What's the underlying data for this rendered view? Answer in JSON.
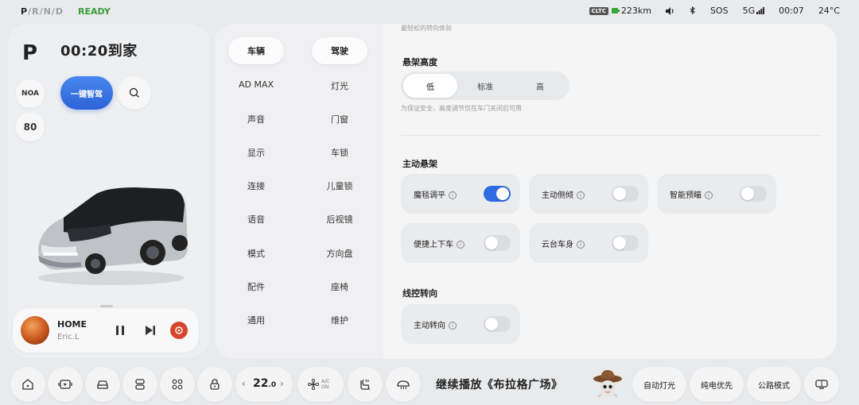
{
  "status": {
    "gears": [
      "P",
      "R",
      "N",
      "D"
    ],
    "ready": "READY",
    "cltc": "CLTC",
    "range": "223km",
    "sos": "SOS",
    "network": "5G",
    "time": "00:07",
    "temperature": "24°C"
  },
  "left": {
    "gear": "P",
    "eta": "00:20到家",
    "noa": "NOA",
    "speed": "80",
    "smart_drive": "一键智驾",
    "music": {
      "title": "HOME",
      "artist": "Eric.L"
    }
  },
  "nav": {
    "tabs": [
      "车辆",
      "驾驶"
    ],
    "left_items": [
      "AD MAX",
      "声音",
      "显示",
      "连接",
      "语音",
      "模式",
      "配件",
      "通用"
    ],
    "right_items": [
      "灯光",
      "门窗",
      "车锁",
      "儿童锁",
      "后视镜",
      "方向盘",
      "座椅",
      "维护"
    ]
  },
  "content": {
    "top_hint": "最轻松的转向体验",
    "suspension_height": {
      "title": "悬架高度",
      "options": [
        "低",
        "标准",
        "高"
      ],
      "selected": "低",
      "note": "为保证安全，高度调节仅在车门关闭后可用"
    },
    "active_suspension": {
      "title": "主动悬架",
      "items": [
        {
          "label": "魔毯调平",
          "on": true
        },
        {
          "label": "主动侧倾",
          "on": false
        },
        {
          "label": "智能预瞄",
          "on": false
        },
        {
          "label": "便捷上下车",
          "on": false
        },
        {
          "label": "云台车身",
          "on": false
        }
      ]
    },
    "steer_by_wire": {
      "title": "线控转向",
      "items": [
        {
          "label": "主动转向",
          "on": false
        }
      ]
    }
  },
  "dock": {
    "temp_int": "22",
    "temp_dec": ".0",
    "ac_label": "A/C ON",
    "now_playing": "继续播放《布拉格广场》",
    "buttons": [
      "自动灯光",
      "纯电优先",
      "公路模式"
    ]
  },
  "colors": {
    "accent": "#2f6be0",
    "ready": "#3a9e3a"
  }
}
